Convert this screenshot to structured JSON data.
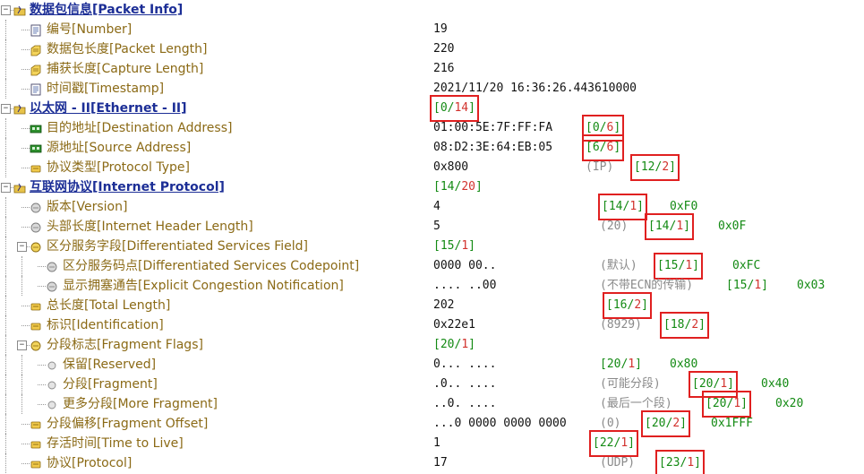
{
  "rows": [
    {
      "level": 0,
      "icon": "folder-icon",
      "label": "数据包信息[Packet Info]",
      "value": "",
      "extra": "",
      "range": {
        "start": "",
        "len": ""
      },
      "hex": "",
      "section": true,
      "expand": "-"
    },
    {
      "level": 1,
      "icon": "document-icon",
      "label": "编号[Number]",
      "value": "19",
      "extra": "",
      "range": {
        "start": "",
        "len": ""
      },
      "hex": ""
    },
    {
      "level": 1,
      "icon": "tag-icon",
      "label": "数据包长度[Packet Length]",
      "value": "220",
      "extra": "",
      "range": {
        "start": "",
        "len": ""
      },
      "hex": ""
    },
    {
      "level": 1,
      "icon": "tag-icon",
      "label": "捕获长度[Capture Length]",
      "value": "216",
      "extra": "",
      "range": {
        "start": "",
        "len": ""
      },
      "hex": ""
    },
    {
      "level": 1,
      "icon": "document-icon",
      "label": "时间戳[Timestamp]",
      "value": "2021/11/20 16:36:26.443610000",
      "extra": "",
      "range": {
        "start": "",
        "len": ""
      },
      "hex": ""
    },
    {
      "level": 0,
      "icon": "folder-icon",
      "label": "以太网 - II[Ethernet - II]",
      "value": "",
      "extra": "",
      "range": {
        "start": "0",
        "len": "14"
      },
      "hex": "",
      "section": true,
      "expand": "-",
      "boxed": true,
      "rangeCol": "val"
    },
    {
      "level": 1,
      "icon": "network-card-icon",
      "label": "目的地址[Destination Address]",
      "value": "01:00:5E:7F:FF:FA",
      "extra": "",
      "range": {
        "start": "0",
        "len": "6"
      },
      "hex": "",
      "boxed": true
    },
    {
      "level": 1,
      "icon": "network-card-icon",
      "label": "源地址[Source Address]",
      "value": "08:D2:3E:64:EB:05",
      "extra": "",
      "range": {
        "start": "6",
        "len": "6"
      },
      "hex": "",
      "boxed": true
    },
    {
      "level": 1,
      "icon": "key-icon",
      "label": "协议类型[Protocol Type]",
      "value": "0x800",
      "extra": "(IP)",
      "range": {
        "start": "12",
        "len": "2"
      },
      "hex": "",
      "boxed": true
    },
    {
      "level": 0,
      "icon": "folder-icon",
      "label": "互联网协议[Internet Protocol]",
      "value": "",
      "extra": "",
      "range": {
        "start": "14",
        "len": "20"
      },
      "hex": "",
      "section": true,
      "expand": "-",
      "rangeCol": "val"
    },
    {
      "level": 1,
      "icon": "circle-icon",
      "label": "版本[Version]",
      "value": "4",
      "extra": "",
      "range": {
        "start": "14",
        "len": "1"
      },
      "hex": "0xF0",
      "boxed": true
    },
    {
      "level": 1,
      "icon": "circle-icon",
      "label": "头部长度[Internet Header Length]",
      "value": "5",
      "extra": "(20)",
      "range": {
        "start": "14",
        "len": "1"
      },
      "hex": "0x0F",
      "boxed": true
    },
    {
      "level": 1,
      "icon": "circle-key-icon",
      "label": "区分服务字段[Differentiated Services Field]",
      "value": "",
      "extra": "",
      "range": {
        "start": "15",
        "len": "1"
      },
      "hex": "",
      "expand": "-",
      "rangeCol": "val"
    },
    {
      "level": 2,
      "icon": "circle-icon",
      "label": "区分服务码点[Differentiated Services Codepoint]",
      "value": "0000 00..",
      "extra": "(默认)",
      "range": {
        "start": "15",
        "len": "1"
      },
      "hex": "0xFC",
      "boxed": true
    },
    {
      "level": 2,
      "icon": "circle-icon",
      "label": "显示拥塞通告[Explicit Congestion Notification]",
      "value": ".... ..00",
      "extra": "(不带ECN的传输)",
      "range": {
        "start": "15",
        "len": "1"
      },
      "hex": "0x03"
    },
    {
      "level": 1,
      "icon": "key-icon",
      "label": "总长度[Total Length]",
      "value": "202",
      "extra": "",
      "range": {
        "start": "16",
        "len": "2"
      },
      "hex": "",
      "boxed": true
    },
    {
      "level": 1,
      "icon": "key-icon",
      "label": "标识[Identification]",
      "value": "0x22e1",
      "extra": "(8929)",
      "range": {
        "start": "18",
        "len": "2"
      },
      "hex": "",
      "boxed": true
    },
    {
      "level": 1,
      "icon": "circle-key-icon",
      "label": "分段标志[Fragment Flags]",
      "value": "",
      "extra": "",
      "range": {
        "start": "20",
        "len": "1"
      },
      "hex": "",
      "expand": "-",
      "rangeCol": "val"
    },
    {
      "level": 2,
      "icon": "small-circle-icon",
      "label": "保留[Reserved]",
      "value": "0... ....",
      "extra": "",
      "range": {
        "start": "20",
        "len": "1"
      },
      "hex": "0x80"
    },
    {
      "level": 2,
      "icon": "small-circle-icon",
      "label": "分段[Fragment]",
      "value": ".0.. ....",
      "extra": "(可能分段)",
      "range": {
        "start": "20",
        "len": "1"
      },
      "hex": "0x40",
      "boxed": true
    },
    {
      "level": 2,
      "icon": "small-circle-icon",
      "label": "更多分段[More Fragment]",
      "value": "..0. ....",
      "extra": "(最后一个段)",
      "range": {
        "start": "20",
        "len": "1"
      },
      "hex": "0x20",
      "boxed": true
    },
    {
      "level": 1,
      "icon": "key-icon",
      "label": "分段偏移[Fragment Offset]",
      "value": "...0 0000 0000 0000",
      "extra": "(0)",
      "range": {
        "start": "20",
        "len": "2"
      },
      "hex": "0x1FFF",
      "boxed": true
    },
    {
      "level": 1,
      "icon": "key-icon",
      "label": "存活时间[Time to Live]",
      "value": "1",
      "extra": "",
      "range": {
        "start": "22",
        "len": "1"
      },
      "hex": "",
      "boxed": true
    },
    {
      "level": 1,
      "icon": "key-icon",
      "label": "协议[Protocol]",
      "value": "17",
      "extra": "(UDP)",
      "range": {
        "start": "23",
        "len": "1"
      },
      "hex": "",
      "boxed": true
    }
  ]
}
